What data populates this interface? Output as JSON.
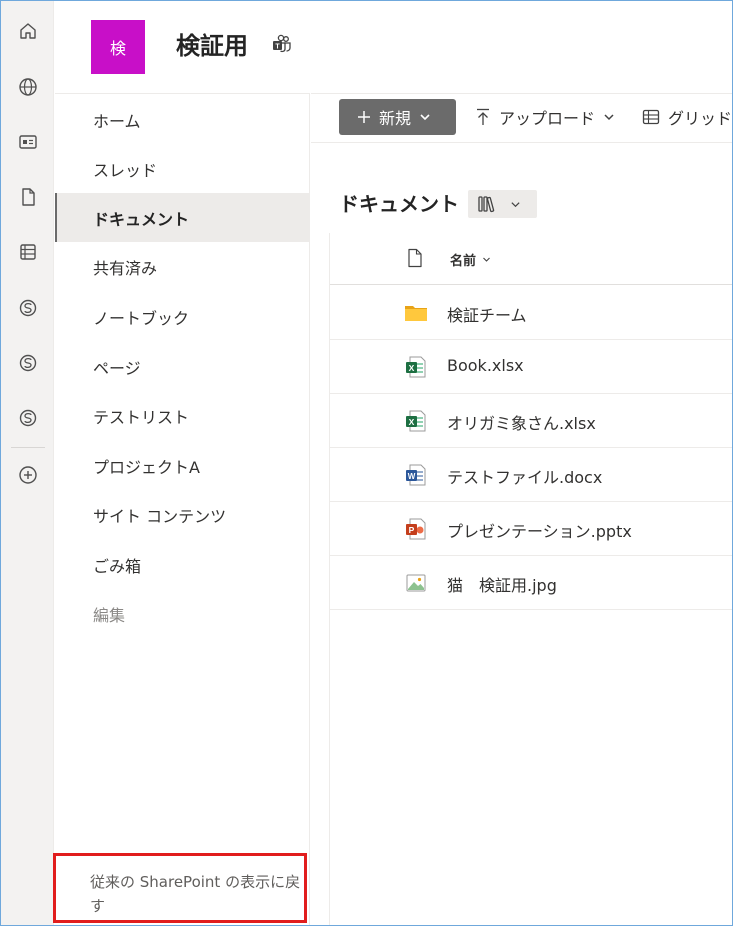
{
  "appbar": {
    "items": [
      {
        "icon": "home-icon"
      },
      {
        "icon": "globe-icon"
      },
      {
        "icon": "news-icon"
      },
      {
        "icon": "file-icon"
      },
      {
        "icon": "list-icon"
      },
      {
        "icon": "sharepoint-site-icon"
      },
      {
        "icon": "sharepoint-site-icon"
      },
      {
        "icon": "sharepoint-site-icon"
      },
      {
        "icon": "add-icon"
      }
    ]
  },
  "site": {
    "logo_letter": "検",
    "logo_color": "#c80fc8",
    "title": "検証用",
    "teams_icon": "teams-icon"
  },
  "nav": {
    "items": [
      {
        "label": "ホーム"
      },
      {
        "label": "スレッド"
      },
      {
        "label": "ドキュメント",
        "selected": true
      },
      {
        "label": "共有済み"
      },
      {
        "label": "ノートブック"
      },
      {
        "label": "ページ"
      },
      {
        "label": "テストリスト"
      },
      {
        "label": "プロジェクトA"
      },
      {
        "label": "サイト コンテンツ"
      },
      {
        "label": "ごみ箱"
      },
      {
        "label": "編集"
      }
    ],
    "classic_link": "従来の SharePoint の表示に戻す"
  },
  "commandbar": {
    "new_label": "新規",
    "upload_label": "アップロード",
    "grid_label": "グリッド"
  },
  "library": {
    "title": "ドキュメント",
    "column_name": "名前",
    "files": [
      {
        "name": "検証チーム",
        "type": "folder"
      },
      {
        "name": "Book.xlsx",
        "type": "excel"
      },
      {
        "name": "オリガミ象さん.xlsx",
        "type": "excel"
      },
      {
        "name": "テストファイル.docx",
        "type": "word"
      },
      {
        "name": "プレゼンテーション.pptx",
        "type": "powerpoint"
      },
      {
        "name": "猫　検証用.jpg",
        "type": "image"
      }
    ]
  },
  "colors": {
    "excel": "#1d6f42",
    "word": "#2b579a",
    "powerpoint": "#c43e1c",
    "folder": "#ffb900",
    "highlight_border": "#e11d1d"
  }
}
